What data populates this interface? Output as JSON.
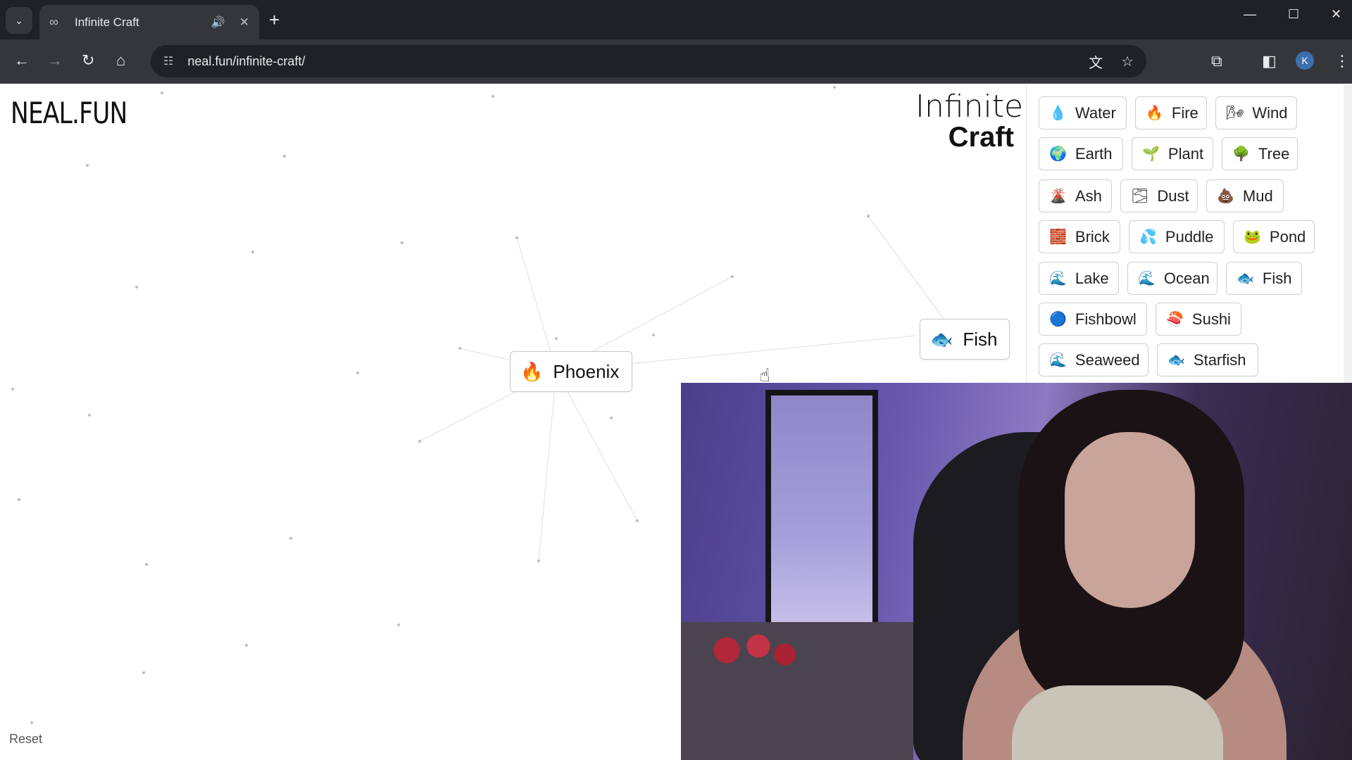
{
  "browser": {
    "tab_title": "Infinite Craft",
    "url": "neal.fun/infinite-craft/",
    "profile_initial": "K"
  },
  "page": {
    "logo": "NEAL.FUN",
    "title_line1": "Infinite",
    "title_line2": "Craft",
    "reset_label": "Reset"
  },
  "canvas_elements": [
    {
      "name": "Phoenix",
      "icon": "fire-icon",
      "glyph": "🔥"
    },
    {
      "name": "Fish",
      "icon": "fish-icon",
      "glyph": "🐟"
    }
  ],
  "sidebar_items": [
    {
      "name": "Water",
      "icon": "droplet-icon",
      "glyph": "💧"
    },
    {
      "name": "Fire",
      "icon": "fire-icon",
      "glyph": "🔥"
    },
    {
      "name": "Wind",
      "icon": "wind-icon",
      "glyph": "🌬"
    },
    {
      "name": "Earth",
      "icon": "globe-icon",
      "glyph": "🌍"
    },
    {
      "name": "Plant",
      "icon": "seedling-icon",
      "glyph": "🌱"
    },
    {
      "name": "Tree",
      "icon": "tree-icon",
      "glyph": "🌳"
    },
    {
      "name": "Ash",
      "icon": "volcano-icon",
      "glyph": "🌋"
    },
    {
      "name": "Dust",
      "icon": "dust-icon",
      "glyph": "🌫"
    },
    {
      "name": "Mud",
      "icon": "mud-icon",
      "glyph": "💩"
    },
    {
      "name": "Brick",
      "icon": "brick-icon",
      "glyph": "🧱"
    },
    {
      "name": "Puddle",
      "icon": "splash-icon",
      "glyph": "💦"
    },
    {
      "name": "Pond",
      "icon": "frog-icon",
      "glyph": "🐸"
    },
    {
      "name": "Lake",
      "icon": "wave-icon",
      "glyph": "🌊"
    },
    {
      "name": "Ocean",
      "icon": "wave-icon",
      "glyph": "🌊"
    },
    {
      "name": "Fish",
      "icon": "fish-icon",
      "glyph": "🐟"
    },
    {
      "name": "Fishbowl",
      "icon": "fishbowl-icon",
      "glyph": "🔵"
    },
    {
      "name": "Sushi",
      "icon": "sushi-icon",
      "glyph": "🍣"
    },
    {
      "name": "Seaweed",
      "icon": "wave-icon",
      "glyph": "🌊"
    },
    {
      "name": "Starfish",
      "icon": "fish-icon",
      "glyph": "🐟"
    }
  ]
}
